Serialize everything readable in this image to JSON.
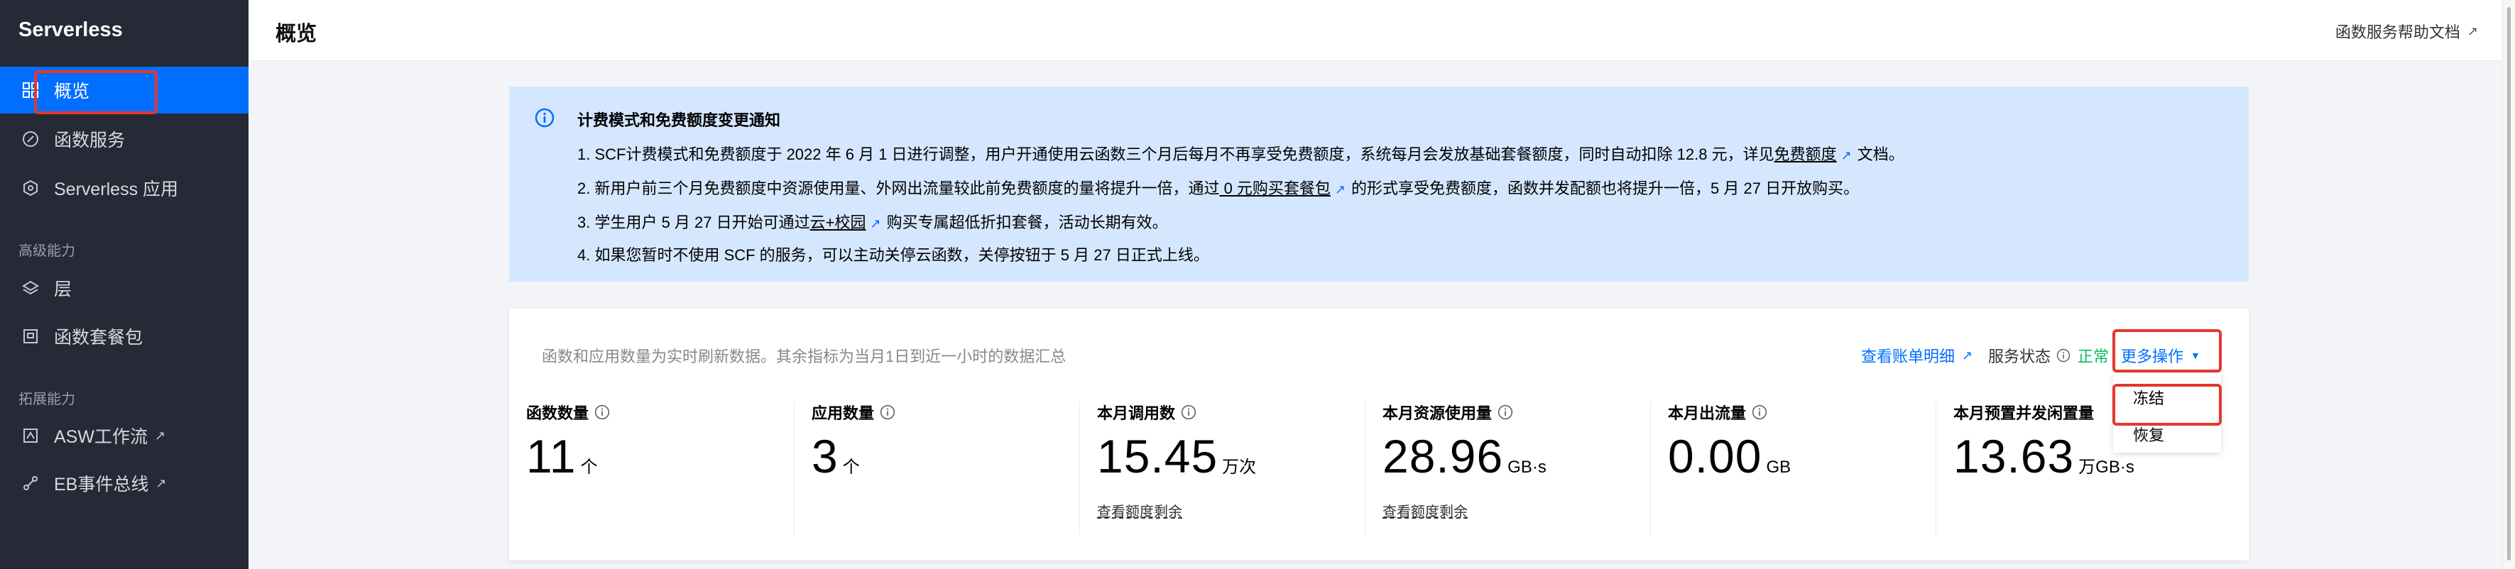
{
  "sidebar": {
    "brand": "Serverless",
    "items": [
      {
        "label": "概览",
        "icon": "grid-icon"
      },
      {
        "label": "函数服务",
        "icon": "function-icon"
      },
      {
        "label": "Serverless 应用",
        "icon": "cube-gear-icon"
      },
      {
        "label": "层",
        "icon": "layers-icon"
      },
      {
        "label": "函数套餐包",
        "icon": "package-icon"
      },
      {
        "label": "ASW工作流",
        "icon": "workflow-icon"
      },
      {
        "label": "EB事件总线",
        "icon": "event-bus-icon"
      }
    ],
    "groups": {
      "advanced": "高级能力",
      "extension": "拓展能力"
    }
  },
  "header": {
    "title": "概览",
    "help_link": "函数服务帮助文档"
  },
  "notice": {
    "title": "计费模式和免费额度变更通知",
    "line1_a": "1. SCF计费模式和免费额度于 2022 年 6 月 1 日进行调整，用户开通使用云函数三个月后每月不再享受免费额度，系统每月会发放基础套餐额度，同时自动扣除 12.8 元，详见",
    "line1_link": "免费额度",
    "line1_b": "文档。",
    "line2_a": "2. 新用户前三个月免费额度中资源使用量、外网出流量较此前免费额度的量将提升一倍，通过",
    "line2_link": " 0 元购买套餐包",
    "line2_b": "的形式享受免费额度，函数并发配额也将提升一倍，5 月 27 日开放购买。",
    "line3_a": "3. 学生用户 5 月 27 日开始可通过",
    "line3_link": "云+校园",
    "line3_b": "购买专属超低折扣套餐，活动长期有效。",
    "line4": "4. 如果您暂时不使用 SCF 的服务，可以主动关停云函数，关停按钮于 5 月 27 日正式上线。"
  },
  "stats": {
    "description": "函数和应用数量为实时刷新数据。其余指标为当月1日到近一小时的数据汇总",
    "bill_link": "查看账单明细",
    "service_status_label": "服务状态",
    "service_status_value": "正常",
    "more_actions": "更多操作",
    "dropdown_options": [
      "冻结",
      "恢复"
    ],
    "metrics": [
      {
        "label": "函数数量",
        "value": "11",
        "unit": "个",
        "link": ""
      },
      {
        "label": "应用数量",
        "value": "3",
        "unit": "个",
        "link": ""
      },
      {
        "label": "本月调用数",
        "value": "15.45",
        "unit": "万次",
        "link": "查看额度剩余"
      },
      {
        "label": "本月资源使用量",
        "value": "28.96",
        "unit": "GB·s",
        "link": "查看额度剩余"
      },
      {
        "label": "本月出流量",
        "value": "0.00",
        "unit": "GB",
        "link": ""
      },
      {
        "label": "本月预置并发闲置量",
        "value": "13.63",
        "unit": "万GB·s",
        "link": ""
      }
    ]
  },
  "colors": {
    "sidebar_bg": "#262a36",
    "active": "#006eff",
    "notice_bg": "#d5e7ff",
    "highlight": "#e5372c",
    "status_ok": "#0abf5b"
  }
}
